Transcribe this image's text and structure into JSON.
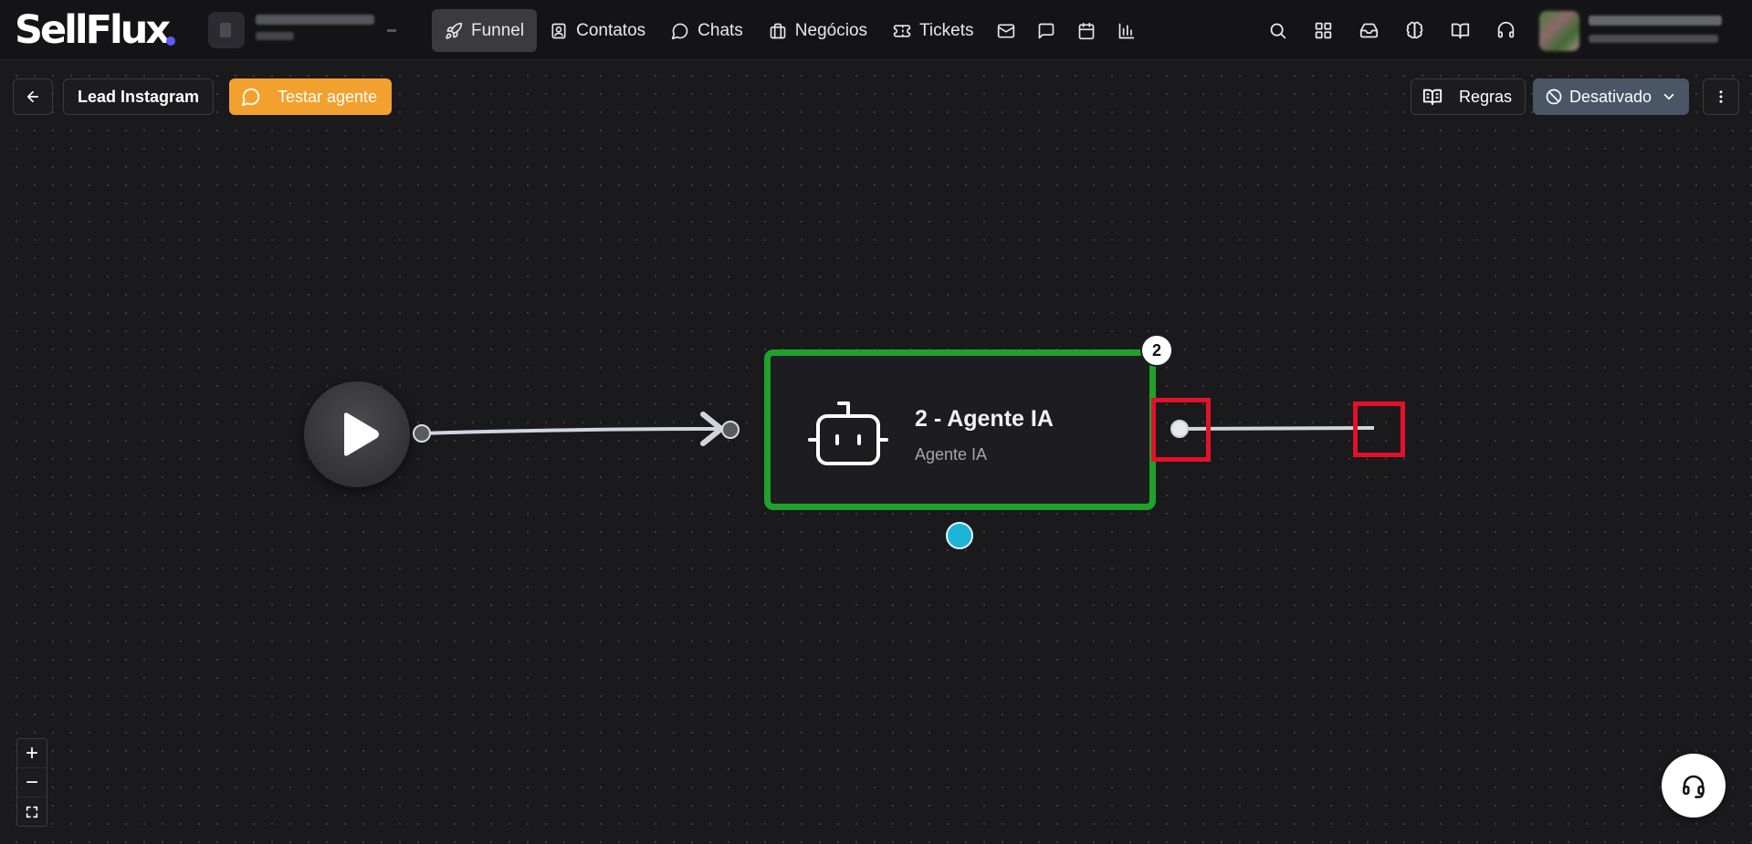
{
  "app": {
    "logo_text": "SellFlux",
    "accent": "#5b5bf0"
  },
  "nav": {
    "items": [
      {
        "label": "Funnel",
        "icon": "rocket-icon",
        "active": true
      },
      {
        "label": "Contatos",
        "icon": "contact-card-icon",
        "active": false
      },
      {
        "label": "Chats",
        "icon": "chat-bubble-icon",
        "active": false
      },
      {
        "label": "Negócios",
        "icon": "briefcase-icon",
        "active": false
      },
      {
        "label": "Tickets",
        "icon": "ticket-icon",
        "active": false
      }
    ],
    "icon_buttons": [
      "mail-icon",
      "message-square-icon",
      "calendar-icon",
      "bar-chart-icon"
    ],
    "right_icons": [
      "search-icon",
      "apps-grid-icon",
      "inbox-icon",
      "brain-icon",
      "book-icon",
      "headset-icon"
    ]
  },
  "toolbar": {
    "flow_name": "Lead Instagram",
    "test_label": "Testar agente",
    "rules_label": "Regras",
    "status_label": "Desativado",
    "test_color": "#f2a12e",
    "status_color": "#4a5566"
  },
  "flow": {
    "node": {
      "badge": "2",
      "title": "2 - Agente IA",
      "subtitle": "Agente IA",
      "icon": "robot-icon",
      "border_color": "#1ea22c"
    },
    "bottom_handle_color": "#1bb6d6",
    "highlight_color": "#e4112b"
  },
  "zoom": {
    "in_label": "+",
    "out_label": "−"
  }
}
